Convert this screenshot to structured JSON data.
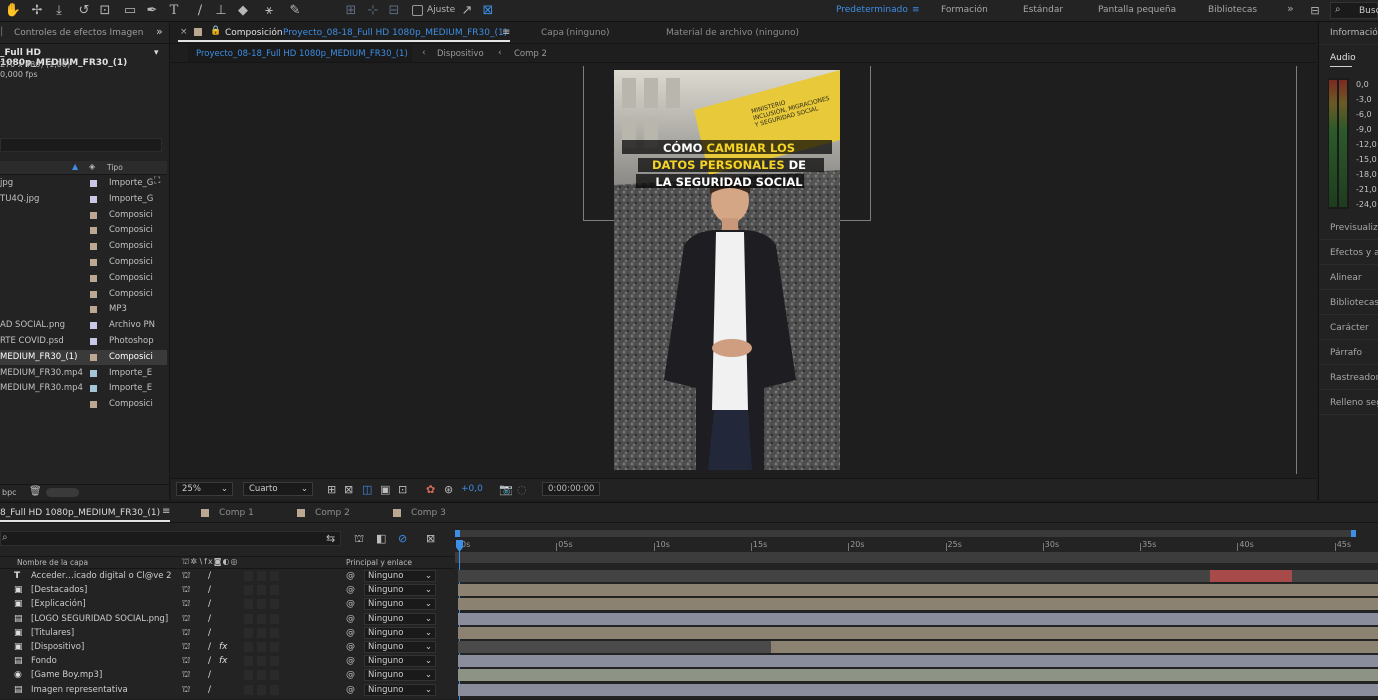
{
  "toolbar": {
    "snap_label": "Ajuste",
    "workspaces": [
      "Predeterminado",
      "Formación",
      "Estándar",
      "Pantalla pequeña",
      "Bibliotecas"
    ],
    "active_workspace": "Predeterminado",
    "search_placeholder": "Busc"
  },
  "project_panel": {
    "tab_label": "Controles de efectos Imagen",
    "selected_item_name": "_Full HD 1080p_MEDIUM_FR30_(1)",
    "selected_item_size": "270 x 480) (1,00)",
    "selected_item_fps": "0,000 fps",
    "col_type": "Tipo",
    "items": [
      {
        "name": "jpg",
        "type": "Importe_G",
        "color": "#c8c8e6"
      },
      {
        "name": "TU4Q.jpg",
        "type": "Importe_G",
        "color": "#c8c8e6"
      },
      {
        "name": "",
        "type": "Composici",
        "color": "#bca892"
      },
      {
        "name": "",
        "type": "Composici",
        "color": "#bca892"
      },
      {
        "name": "",
        "type": "Composici",
        "color": "#bca892"
      },
      {
        "name": "",
        "type": "Composici",
        "color": "#bca892"
      },
      {
        "name": "",
        "type": "Composici",
        "color": "#bca892"
      },
      {
        "name": "",
        "type": "Composici",
        "color": "#bca892"
      },
      {
        "name": "",
        "type": "MP3",
        "color": "#bca892"
      },
      {
        "name": "AD SOCIAL.png",
        "type": "Archivo PN",
        "color": "#c8c8e6"
      },
      {
        "name": "RTE COVID.psd",
        "type": "Photoshop",
        "color": "#c8c8e6"
      },
      {
        "name": "MEDIUM_FR30_(1)",
        "type": "Composici",
        "color": "#bca892"
      },
      {
        "name": "MEDIUM_FR30.mp4",
        "type": "Importe_E",
        "color": "#a3c6d6"
      },
      {
        "name": "MEDIUM_FR30.mp4",
        "type": "Importe_E",
        "color": "#a3c6d6"
      },
      {
        "name": "",
        "type": "Composici",
        "color": "#bca892"
      }
    ],
    "bpc": "bpc"
  },
  "composition_panel": {
    "tab_prefix": "Composición",
    "tab_name": "Proyecto_08-18_Full HD 1080p_MEDIUM_FR30_(1)",
    "layer_tab": "Capa",
    "layer_value": "(ninguno)",
    "footage_tab": "Material de archivo (ninguno)",
    "breadcrumbs": [
      "Proyecto_08-18_Full HD 1080p_MEDIUM_FR30_(1)",
      "Dispositivo",
      "Comp 2"
    ],
    "zoom": "25%",
    "resolution": "Cuarto",
    "exposure": "+0,0",
    "timecode": "0:00:00:00",
    "thumbnail": {
      "title_line1_white": "CÓMO ",
      "title_line1_yellow": "CAMBIAR LOS",
      "title_line2_yellow": "DATOS PERSONALES",
      "title_line2_white": " DE",
      "title_line3": "LA SEGURIDAD SOCIAL",
      "sign_line1": "MINISTERIO",
      "sign_line2": "INCLUSIÓN, MIGRACIONES",
      "sign_line3": "Y SEGURIDAD SOCIAL"
    }
  },
  "right_panel": {
    "info": "Información",
    "audio": "Audio",
    "meter_levels": [
      "0,0",
      "-3,0",
      "-6,0",
      "-9,0",
      "-12,0",
      "-15,0",
      "-18,0",
      "-21,0",
      "-24,0"
    ],
    "panels": [
      "Previsualiza",
      "Efectos y aj",
      "Alinear",
      "Bibliotecas",
      "Carácter",
      "Párrafo",
      "Rastreador",
      "Relleno seg"
    ]
  },
  "timeline": {
    "active_tab": "8_Full HD 1080p_MEDIUM_FR30_(1)",
    "tabs": [
      "Comp 1",
      "Comp 2",
      "Comp 3"
    ],
    "col_layer_name": "Nombre de la capa",
    "col_parent": "Principal y enlace",
    "ruler": [
      "0s",
      "05s",
      "10s",
      "15s",
      "20s",
      "25s",
      "30s",
      "35s",
      "40s",
      "45s"
    ],
    "layers": [
      {
        "name": "Acceder…icado digital o Cl@ve 2",
        "kind": "text",
        "fx": false,
        "parent": "Ninguno"
      },
      {
        "name": "[Destacados]",
        "kind": "comp",
        "fx": false,
        "parent": "Ninguno"
      },
      {
        "name": "[Explicación]",
        "kind": "comp",
        "fx": false,
        "parent": "Ninguno"
      },
      {
        "name": "[LOGO SEGURIDAD SOCIAL.png]",
        "kind": "file",
        "fx": false,
        "parent": "Ninguno"
      },
      {
        "name": "[Titulares]",
        "kind": "comp",
        "fx": false,
        "parent": "Ninguno"
      },
      {
        "name": "[Dispositivo]",
        "kind": "comp",
        "fx": true,
        "parent": "Ninguno"
      },
      {
        "name": "Fondo",
        "kind": "file",
        "fx": true,
        "parent": "Ninguno"
      },
      {
        "name": "[Game Boy.mp3]",
        "kind": "audio",
        "fx": false,
        "parent": "Ninguno"
      },
      {
        "name": "Imagen representativa",
        "kind": "file",
        "fx": false,
        "parent": "Ninguno"
      }
    ]
  },
  "colors": {
    "accent_blue": "#3d8ee5",
    "title_yellow": "#f5d327",
    "bar_tan": "#8b8272",
    "bar_gray": "#8a8e9c",
    "bar_audio": "#8d9485",
    "bar_text_highlight": "#a84a4a"
  }
}
